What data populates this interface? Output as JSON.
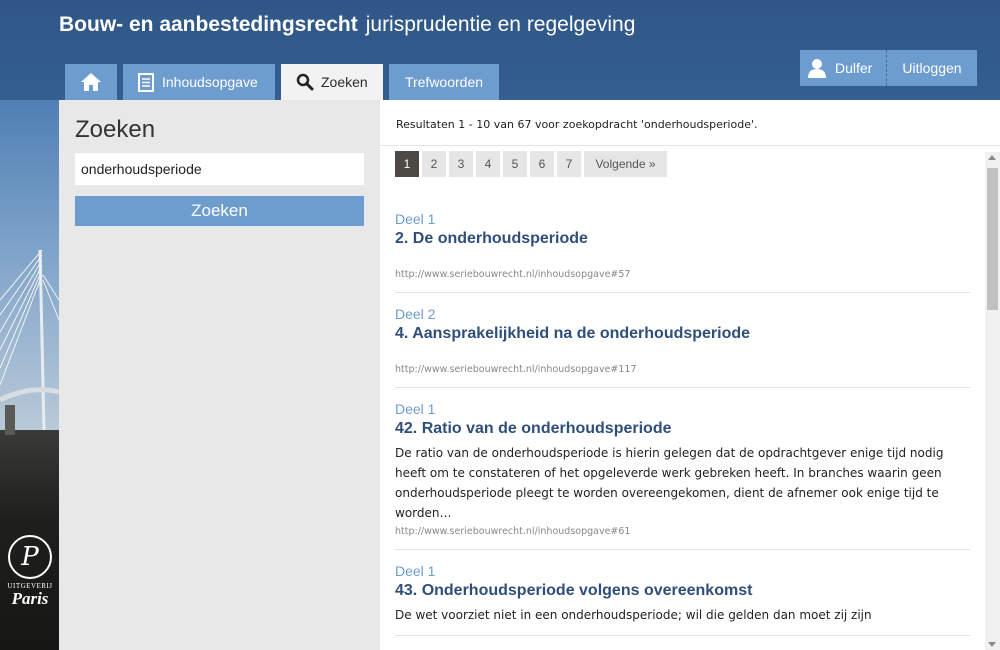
{
  "header": {
    "title_bold": "Bouw- en aanbestedingsrecht",
    "title_light": "jurisprudentie en regelgeving"
  },
  "tabs": [
    {
      "label": "",
      "icon": "home-icon"
    },
    {
      "label": "Inhoudsopgave",
      "icon": "document-icon"
    },
    {
      "label": "Zoeken",
      "icon": "search-icon",
      "active": true
    },
    {
      "label": "Trefwoorden"
    }
  ],
  "user": {
    "name": "Dulfer",
    "logout_label": "Uitloggen",
    "icon": "user-icon"
  },
  "sidebar": {
    "heading": "Zoeken",
    "search_value": "onderhoudsperiode",
    "search_button": "Zoeken"
  },
  "logo": {
    "small_text": "UITGEVERIJ",
    "name": "Paris"
  },
  "main": {
    "result_count": "Resultaten 1 - 10 van 67 voor zoekopdracht 'onderhoudsperiode'.",
    "pages": [
      "1",
      "2",
      "3",
      "4",
      "5",
      "6",
      "7"
    ],
    "current_page": "1",
    "next_label": "Volgende »",
    "results": [
      {
        "part": "Deel 1",
        "title": "2. De onderhoudsperiode",
        "snippet": "",
        "url": "http://www.seriebouwrecht.nl/inhoudsopgave#57"
      },
      {
        "part": "Deel 2",
        "title": "4. Aansprakelijkheid na de onderhoudsperiode",
        "snippet": "",
        "url": "http://www.seriebouwrecht.nl/inhoudsopgave#117"
      },
      {
        "part": "Deel 1",
        "title": "42. Ratio van de onderhoudsperiode",
        "snippet": "De ratio van de onderhoudsperiode is hierin gelegen dat de opdrachtgever enige tijd nodig heeft om te constateren of het opgeleverde werk gebreken heeft. In branches waarin geen onderhoudsperiode pleegt te worden overeengekomen, dient de afnemer ook enige tijd te worden…",
        "url": "http://www.seriebouwrecht.nl/inhoudsopgave#61"
      },
      {
        "part": "Deel 1",
        "title": "43. Onderhoudsperiode volgens overeenkomst",
        "snippet": "De wet voorziet niet in een onderhoudsperiode; wil die gelden dan moet zij zijn",
        "url": ""
      }
    ]
  },
  "colors": {
    "accent": "#6d9ccf",
    "header_bg": "#3d6da3",
    "title_blue": "#2f4f7a",
    "current_page": "#4d4a45"
  }
}
